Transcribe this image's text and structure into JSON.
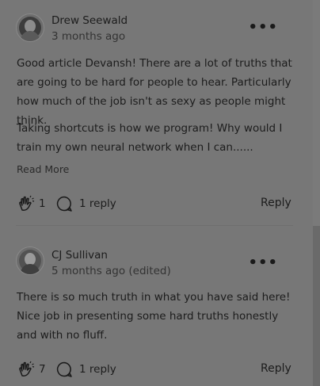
{
  "comments": [
    {
      "author": "Drew Seewald",
      "timestamp": "3 months ago",
      "paragraphs": [
        "Good article Devansh! There are a lot of truths that are going to be hard for people to hear. Particularly how much of the job isn't as sexy as people might think.",
        "Taking shortcuts is how we program! Why would I train my own neural network when I can......"
      ],
      "read_more": "Read More",
      "claps": "1",
      "replies": "1 reply",
      "reply_label": "Reply"
    },
    {
      "author": "CJ Sullivan",
      "timestamp": "5 months ago (edited)",
      "paragraphs": [
        "There is so much truth in what you have said here! Nice job in presenting some hard truths honestly and with no fluff."
      ],
      "claps": "7",
      "replies": "1 reply",
      "reply_label": "Reply"
    }
  ],
  "icons": {
    "more": "more-options-icon",
    "clap": "clap-icon",
    "reply": "reply-bubble-icon"
  },
  "colors": {
    "overlay_background": "#777777",
    "text": "#1c1c1c"
  }
}
